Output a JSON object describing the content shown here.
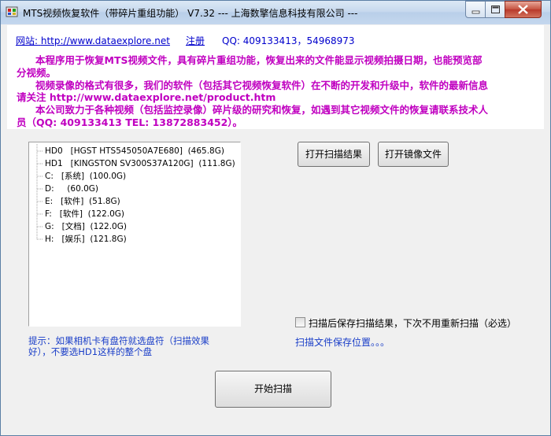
{
  "window": {
    "title": "MTS视频恢复软件（带碎片重组功能） V7.32 --- 上海数擎信息科技有限公司 ---"
  },
  "header": {
    "website_label": "网站:",
    "website_url": "http://www.dataexplore.net",
    "register_label": "注册",
    "qq_text": "QQ:  409133413，54968973"
  },
  "intro": {
    "para1": "本程序用于恢复MTS视频文件，具有碎片重组功能，恢复出来的文件能显示视频拍摄日期，也能预览部分视频。",
    "para2": "视频录像的格式有很多，我们的软件（包括其它视频恢复软件）在不断的开发和升级中，软件的最新信息请关注 http://www.dataexplore.net/product.htm",
    "para3": "本公司致力于各种视频（包括监控录像）碎片级的研究和恢复，如遇到其它视频文件的恢复请联系技术人员（QQ: 409133413 TEL: 13872883452）。"
  },
  "drives": [
    {
      "id": "HD0",
      "text": "HD0   [HGST HTS545050A7E680]  (465.8G)"
    },
    {
      "id": "HD1",
      "text": "HD1   [KINGSTON SV300S37A120G]  (111.8G)"
    },
    {
      "id": "C",
      "text": "C:   [系统]  (100.0G)"
    },
    {
      "id": "D",
      "text": "D:     (60.0G)"
    },
    {
      "id": "E",
      "text": "E:   [软件]  (51.8G)"
    },
    {
      "id": "F",
      "text": "F:   [软件]  (122.0G)"
    },
    {
      "id": "G",
      "text": "G:   [文档]  (122.0G)"
    },
    {
      "id": "H",
      "text": "H:   [娱乐]  (121.8G)"
    }
  ],
  "buttons": {
    "open_scan_result": "打开扫描结果",
    "open_image_file": "打开镜像文件",
    "start_scan": "开始扫描"
  },
  "options": {
    "save_after_scan_label": "扫描后保存扫描结果，下次不用重新扫描（必选）",
    "save_after_scan_checked": false,
    "save_location": "扫描文件保存位置。。。"
  },
  "hint": "提示：如果相机卡有盘符就选盘符（扫描效果好），不要选HD1这样的整个盘",
  "colors": {
    "intro_text": "#c000c0",
    "link": "#0000cc",
    "hint_text": "#1a3ec8"
  }
}
